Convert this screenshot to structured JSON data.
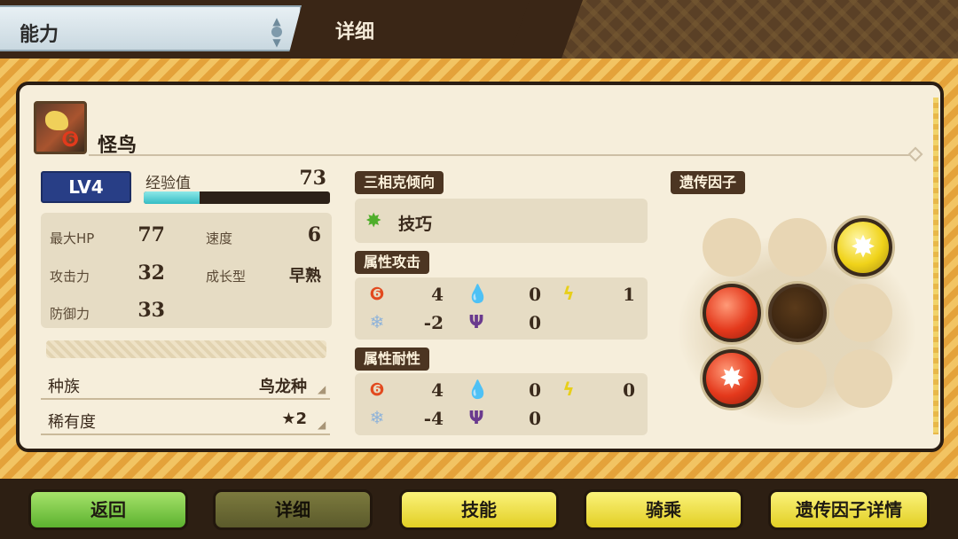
{
  "header": {
    "menu_label": "能力",
    "title": "详细"
  },
  "monster": {
    "name": "怪鸟",
    "icon": "yian-kut-ku-portrait-icon",
    "element_badge": "fire-icon"
  },
  "level": {
    "label": "LV4",
    "exp_label": "经验值",
    "exp_value": "73",
    "exp_progress_fraction": 0.3
  },
  "stats": {
    "max_hp_label": "最大HP",
    "max_hp_value": "77",
    "speed_label": "速度",
    "speed_value": "6",
    "attack_label": "攻击力",
    "attack_value": "32",
    "growth_label": "成长型",
    "growth_value": "早熟",
    "defense_label": "防御力",
    "defense_value": "33"
  },
  "info": {
    "species_label": "种族",
    "species_value": "鸟龙种",
    "rarity_label": "稀有度",
    "rarity_value": "★2"
  },
  "affinity": {
    "label": "三相克倾向",
    "value": "技巧",
    "icon": "technical-splat-icon"
  },
  "element_attack": {
    "label": "属性攻击",
    "fire": "4",
    "water": "0",
    "thunder": "1",
    "ice": "-2",
    "dragon": "0"
  },
  "element_resist": {
    "label": "属性耐性",
    "fire": "4",
    "water": "0",
    "thunder": "0",
    "ice": "-4",
    "dragon": "0"
  },
  "genes": {
    "label": "遗传因子",
    "grid": [
      [
        "empty",
        "empty",
        "yellow-technical"
      ],
      [
        "red",
        "dark",
        "empty"
      ],
      [
        "red-technical",
        "empty",
        "empty"
      ]
    ]
  },
  "footer": {
    "back": "返回",
    "details": "详细",
    "skills": "技能",
    "ride": "骑乘",
    "gene_details": "遗传因子详情"
  },
  "colors": {
    "frame_orange": "#e4a23a",
    "panel_bg": "#f6eedb",
    "level_badge": "#283e86",
    "exp_fill": "#35bcc4",
    "button_green": "#5cb22f",
    "button_yellow": "#e2cf24"
  }
}
